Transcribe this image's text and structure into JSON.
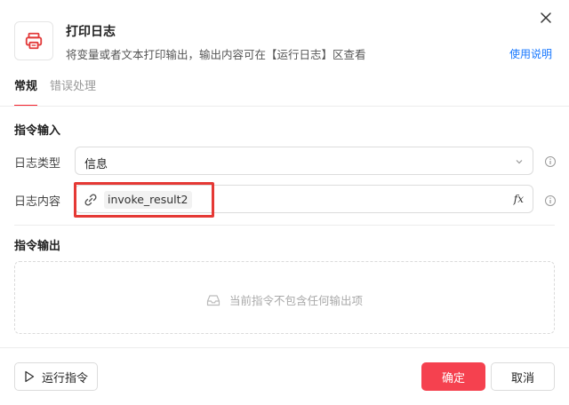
{
  "dialog": {
    "title": "打印日志",
    "subtitle": "将变量或者文本打印输出，输出内容可在【运行日志】区查看",
    "help_link": "使用说明",
    "icon": "printer-icon"
  },
  "tabs": [
    {
      "label": "常规",
      "active": true
    },
    {
      "label": "错误处理",
      "active": false
    }
  ],
  "input_section": {
    "title": "指令输入",
    "log_type": {
      "label": "日志类型",
      "value": "信息"
    },
    "log_content": {
      "label": "日志内容",
      "variable": "invoke_result2",
      "fx_label": "fx"
    }
  },
  "output_section": {
    "title": "指令输出",
    "empty_text": "当前指令不包含任何输出项"
  },
  "footer": {
    "run_label": "运行指令",
    "ok_label": "确定",
    "cancel_label": "取消"
  },
  "colors": {
    "accent": "#f5414f",
    "link": "#1677ff",
    "highlight": "#e53935"
  }
}
